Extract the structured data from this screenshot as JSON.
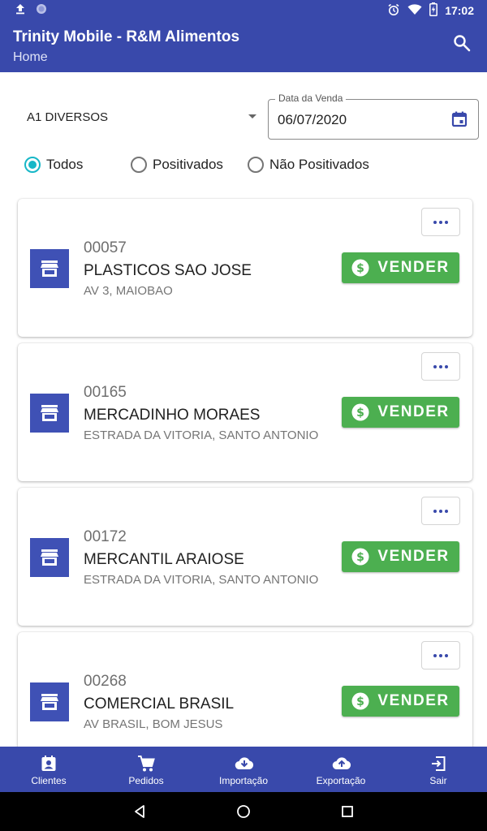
{
  "status_bar": {
    "time": "17:02",
    "left_icons": [
      "upload-icon",
      "notification-dot-icon"
    ],
    "right_icons": [
      "alarm-icon",
      "wifi-icon",
      "battery-icon"
    ]
  },
  "app_bar": {
    "title": "Trinity Mobile - R&M Alimentos",
    "subtitle": "Home",
    "action_icon": "search-icon"
  },
  "filters": {
    "route_select": {
      "value": "A1 DIVERSOS"
    },
    "sale_date": {
      "label": "Data da Venda",
      "value": "06/07/2020",
      "icon": "calendar-icon"
    },
    "status_options": [
      {
        "label": "Todos",
        "checked": true
      },
      {
        "label": "Positivados",
        "checked": false
      },
      {
        "label": "Não Positivados",
        "checked": false
      }
    ]
  },
  "clients": [
    {
      "code": "00057",
      "name": "PLASTICOS SAO JOSE",
      "address": "AV 3, MAIOBAO",
      "action_label": "VENDER"
    },
    {
      "code": "00165",
      "name": "MERCADINHO MORAES",
      "address": "ESTRADA DA VITORIA, SANTO ANTONIO",
      "action_label": "VENDER"
    },
    {
      "code": "00172",
      "name": "MERCANTIL ARAIOSE",
      "address": "ESTRADA DA VITORIA, SANTO ANTONIO",
      "action_label": "VENDER"
    },
    {
      "code": "00268",
      "name": "COMERCIAL BRASIL",
      "address": "AV BRASIL, BOM JESUS",
      "action_label": "VENDER"
    }
  ],
  "bottom_nav": [
    {
      "label": "Clientes",
      "icon": "contacts-icon"
    },
    {
      "label": "Pedidos",
      "icon": "cart-icon"
    },
    {
      "label": "Importação",
      "icon": "cloud-download-icon"
    },
    {
      "label": "Exportação",
      "icon": "cloud-upload-icon"
    },
    {
      "label": "Sair",
      "icon": "exit-icon"
    }
  ],
  "colors": {
    "primary": "#3949ab",
    "store_badge": "#3f51b5",
    "sell_button": "#4caf50",
    "radio_accent": "#17b7c7"
  }
}
